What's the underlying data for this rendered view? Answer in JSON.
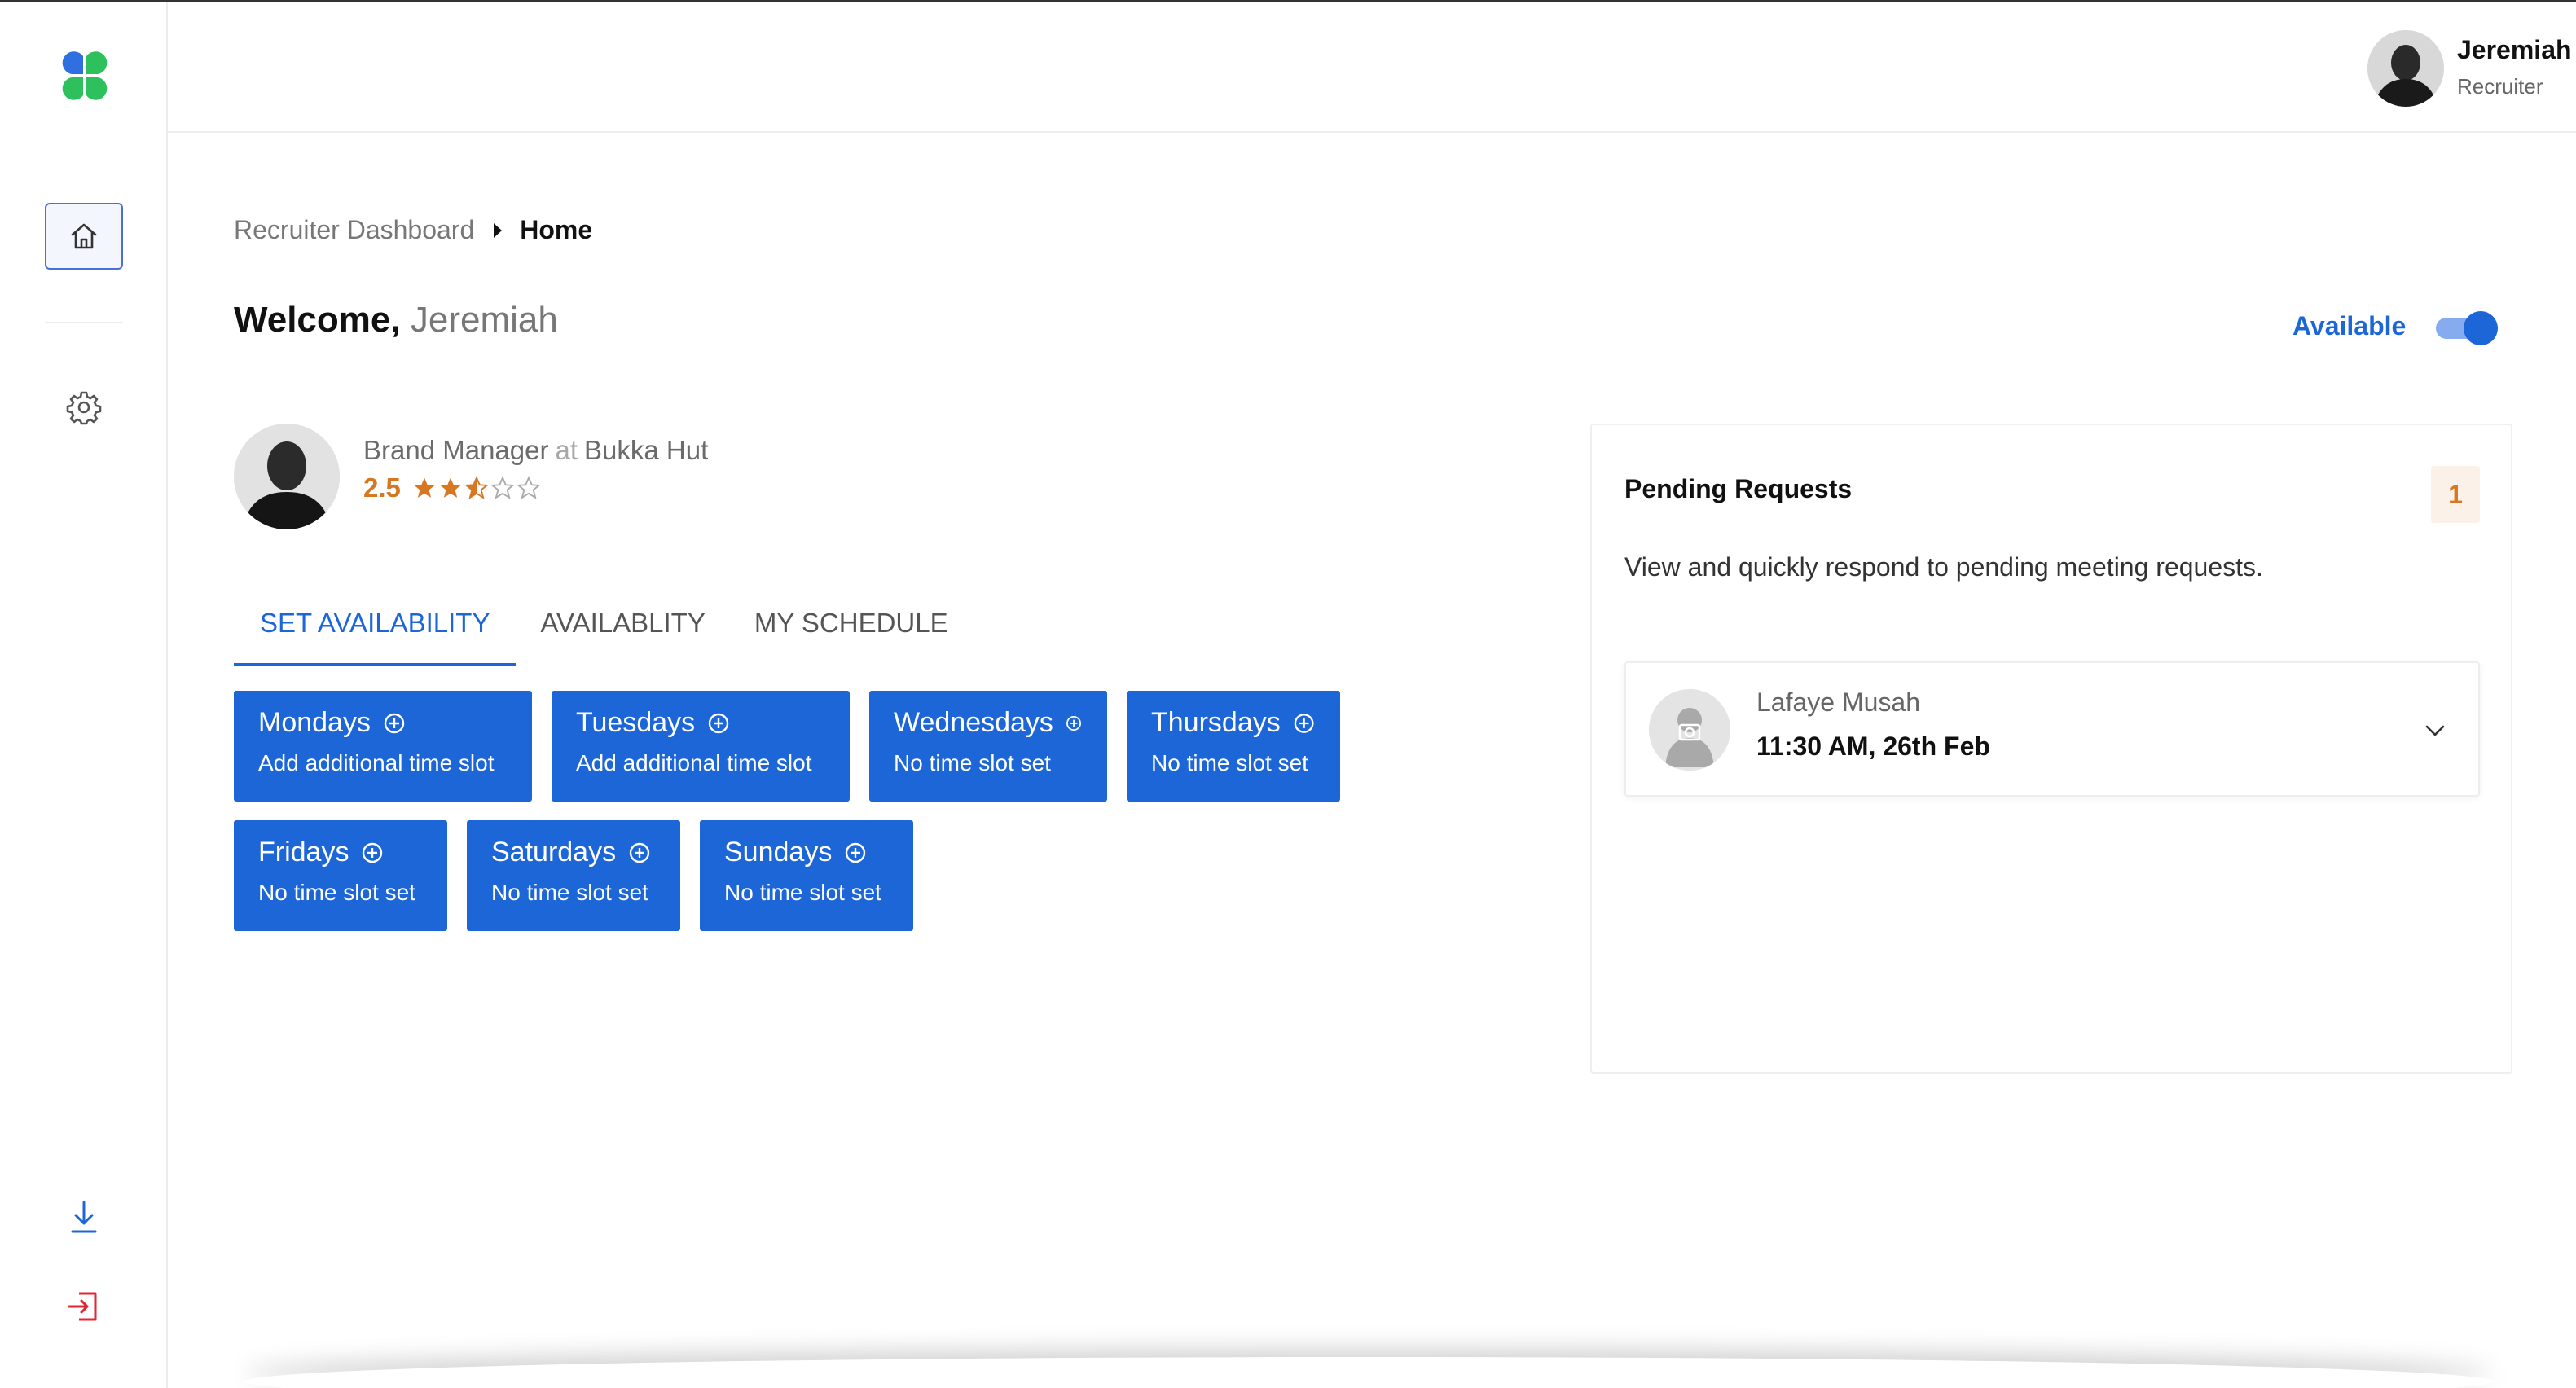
{
  "user": {
    "name": "Jeremiah Johnson",
    "role": "Recruiter"
  },
  "breadcrumb": {
    "parent": "Recruiter Dashboard",
    "current": "Home"
  },
  "welcome": {
    "label": "Welcome,",
    "name": "Jeremiah"
  },
  "availability": {
    "label": "Available",
    "on": true
  },
  "profile": {
    "role": "Brand Manager",
    "at": "at",
    "company": "Bukka Hut",
    "rating": "2.5",
    "rating_value": 2.5,
    "rating_max": 5
  },
  "tabs": [
    {
      "label": "SET AVAILABILITY",
      "active": true
    },
    {
      "label": "AVAILABLITY",
      "active": false
    },
    {
      "label": "MY SCHEDULE",
      "active": false
    }
  ],
  "days": [
    {
      "name": "Mondays",
      "status": "Add additional time slot"
    },
    {
      "name": "Tuesdays",
      "status": "Add additional time slot"
    },
    {
      "name": "Wednesdays",
      "status": "No time slot set"
    },
    {
      "name": "Thursdays",
      "status": "No time slot set"
    },
    {
      "name": "Fridays",
      "status": "No time slot set"
    },
    {
      "name": "Saturdays",
      "status": "No time slot set"
    },
    {
      "name": "Sundays",
      "status": "No time slot set"
    }
  ],
  "pending": {
    "title": "Pending Requests",
    "count": "1",
    "description": "View and quickly respond to pending meeting requests.",
    "requests": [
      {
        "name": "Lafaye Musah",
        "time": "11:30 AM, 26th Feb"
      }
    ]
  },
  "colors": {
    "primary": "#1d66d8",
    "rating": "#d87722",
    "logo_blue": "#2f6fe0",
    "logo_green": "#2fc05e",
    "logout": "#e0262f"
  }
}
